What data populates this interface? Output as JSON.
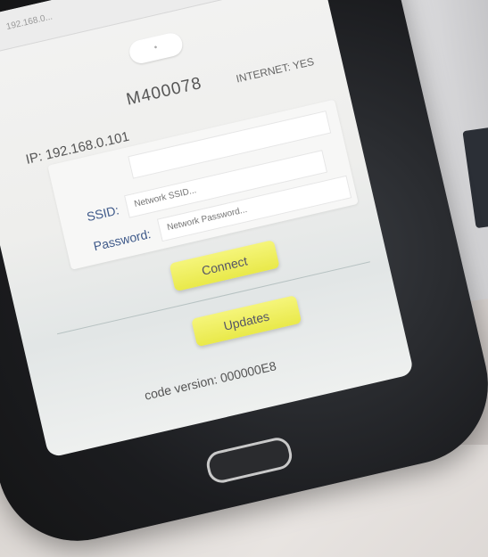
{
  "browser": {
    "url": "192.168.0..."
  },
  "header": {
    "device_name": "M400078",
    "internet_status": "INTERNET: YES",
    "ip": "IP: 192.168.0.101"
  },
  "form": {
    "ssid_label": "SSID:",
    "ssid_placeholder": "Network SSID...",
    "password_label": "Password:",
    "password_placeholder": "Network Password...",
    "connect_label": "Connect"
  },
  "updates": {
    "button_label": "Updates"
  },
  "footer": {
    "code_version": "code version: 000000E8"
  },
  "colors": {
    "button_yellow": "#eeee55",
    "label_blue": "#3f5a8a"
  }
}
